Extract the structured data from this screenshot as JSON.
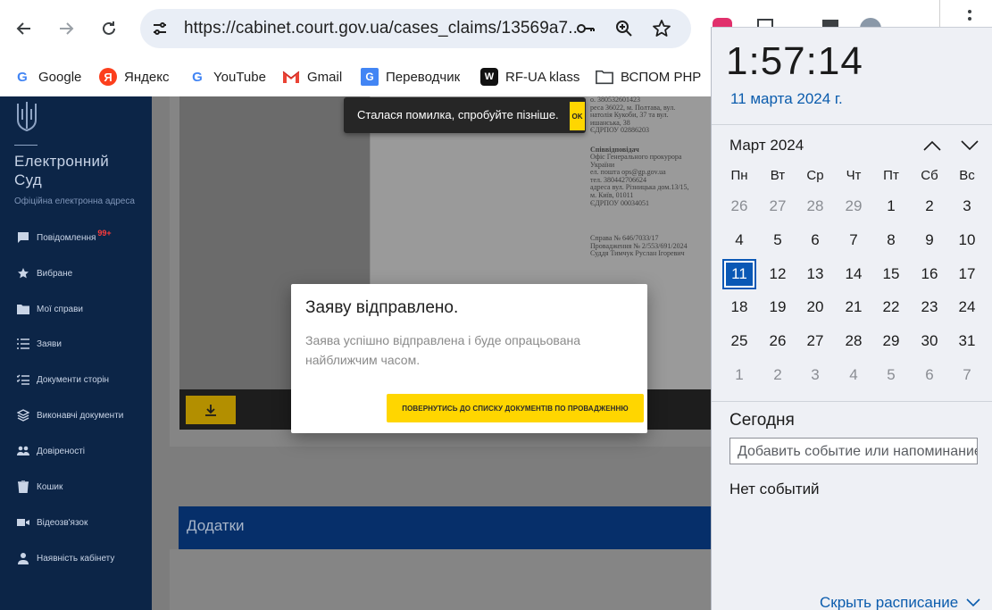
{
  "browser": {
    "url": "https://cabinet.court.gov.ua/cases_claims/13569a7...",
    "bookmarks": [
      {
        "label": "Google",
        "icon": "google-icon"
      },
      {
        "label": "Яндекс",
        "icon": "yandex-icon"
      },
      {
        "label": "YouTube",
        "icon": "google-icon"
      },
      {
        "label": "Gmail",
        "icon": "gmail-icon"
      },
      {
        "label": "Переводчик",
        "icon": "translate-icon"
      },
      {
        "label": "RF-UA klass",
        "icon": "rf-ua-icon"
      },
      {
        "label": "ВСПОМ PHP",
        "icon": "folder-icon"
      }
    ]
  },
  "sidebar": {
    "title": "Електронний Суд",
    "subtitle": "Офіційна електронна адреса",
    "items": [
      {
        "label": "Повідомлення",
        "badge": "99+",
        "icon": "message-icon"
      },
      {
        "label": "Вибране",
        "icon": "star-icon"
      },
      {
        "label": "Мої справи",
        "icon": "folder-icon"
      },
      {
        "label": "Заяви",
        "icon": "list-icon"
      },
      {
        "label": "Документи сторін",
        "icon": "checklist-icon"
      },
      {
        "label": "Виконавчі документи",
        "icon": "layers-icon"
      },
      {
        "label": "Довіреності",
        "icon": "people-icon"
      },
      {
        "label": "Кошик",
        "icon": "trash-icon"
      },
      {
        "label": "Відеозв'язок",
        "icon": "video-icon"
      },
      {
        "label": "Наявність кабінету",
        "icon": "person-icon"
      }
    ]
  },
  "document": {
    "top_lines": "о. 380532601423\nреса 36022, м. Полтава, вул.\nнатолія Кукоби, 37 та вул.\nишанська, 38\nЄДРПОУ 02886203",
    "co_title": "Співвідповідач",
    "co_lines": "Офіс Генерального прокурора\nУкраїни\nел. пошта ops@gp.gov.ua\nтел. 380442706624\nадреса вул. Різницька дом.13/15,\nм. Київ, 01011\nЄДРПОУ 00034051",
    "case_lines": "Справа № 646/7033/17\nПровадження № 2/553/691/2024\nСуддя Тимчук Руслан Ігоревич"
  },
  "snackbar": {
    "message": "Сталася помилка, спробуйте пізніше.",
    "ok": "OK"
  },
  "modal": {
    "title": "Заяву відправлено.",
    "body": "Заява успішно відправлена і буде опрацьована найближчим часом.",
    "button": "ПОВЕРНУТИСЬ ДО СПИСКУ ДОКУМЕНТІВ ПО ПРОВАДЖЕННЮ"
  },
  "addons": {
    "title": "Додатки"
  },
  "calendar": {
    "time": "1:57:14",
    "date": "11 марта 2024 г.",
    "month": "Март 2024",
    "weekdays": [
      "Пн",
      "Вт",
      "Ср",
      "Чт",
      "Пт",
      "Сб",
      "Вс"
    ],
    "weeks": [
      [
        "26",
        "27",
        "28",
        "29",
        "1",
        "2",
        "3"
      ],
      [
        "4",
        "5",
        "6",
        "7",
        "8",
        "9",
        "10"
      ],
      [
        "11",
        "12",
        "13",
        "14",
        "15",
        "16",
        "17"
      ],
      [
        "18",
        "19",
        "20",
        "21",
        "22",
        "23",
        "24"
      ],
      [
        "25",
        "26",
        "27",
        "28",
        "29",
        "30",
        "31"
      ],
      [
        "1",
        "2",
        "3",
        "4",
        "5",
        "6",
        "7"
      ]
    ],
    "selected_day": "11",
    "today_label": "Сегодня",
    "event_placeholder": "Добавить событие или напоминание",
    "no_events": "Нет событий",
    "hide_schedule": "Скрыть расписание"
  }
}
